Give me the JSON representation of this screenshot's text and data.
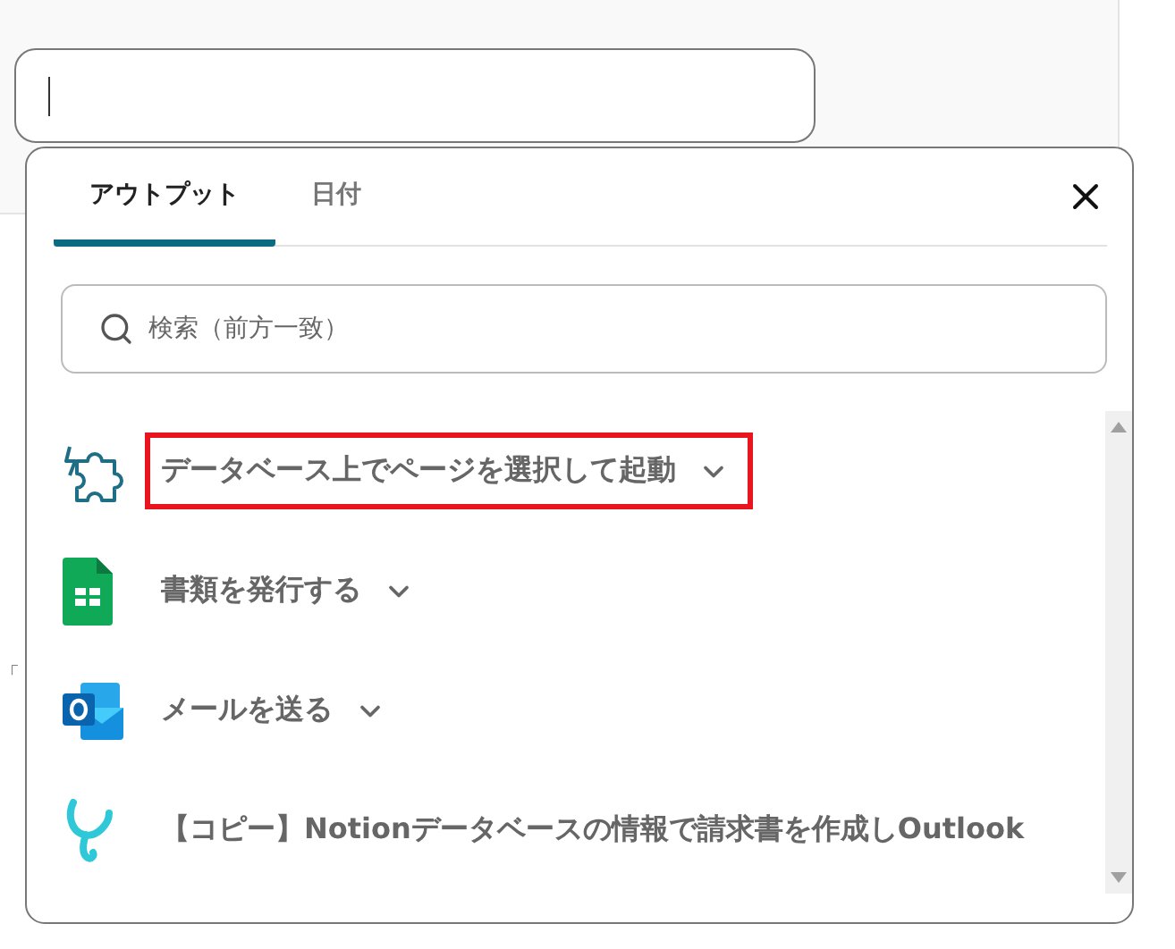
{
  "page_fragment": "「",
  "popover": {
    "tabs": [
      {
        "label": "アウトプット",
        "selected": true
      },
      {
        "label": "日付",
        "selected": false
      }
    ],
    "search": {
      "placeholder": "検索（前方一致）"
    },
    "items": [
      {
        "kind": "puzzle",
        "label": "データベース上でページを選択して起動",
        "expandable": true,
        "highlighted": true
      },
      {
        "kind": "sheets",
        "label": "書類を発行する",
        "expandable": true,
        "highlighted": false
      },
      {
        "kind": "outlook",
        "label": "メールを送る",
        "expandable": true,
        "highlighted": false
      },
      {
        "kind": "flow",
        "label": "【コピー】Notionデータベースの情報で請求書を作成しOutlook",
        "expandable": false,
        "highlighted": false
      }
    ]
  }
}
